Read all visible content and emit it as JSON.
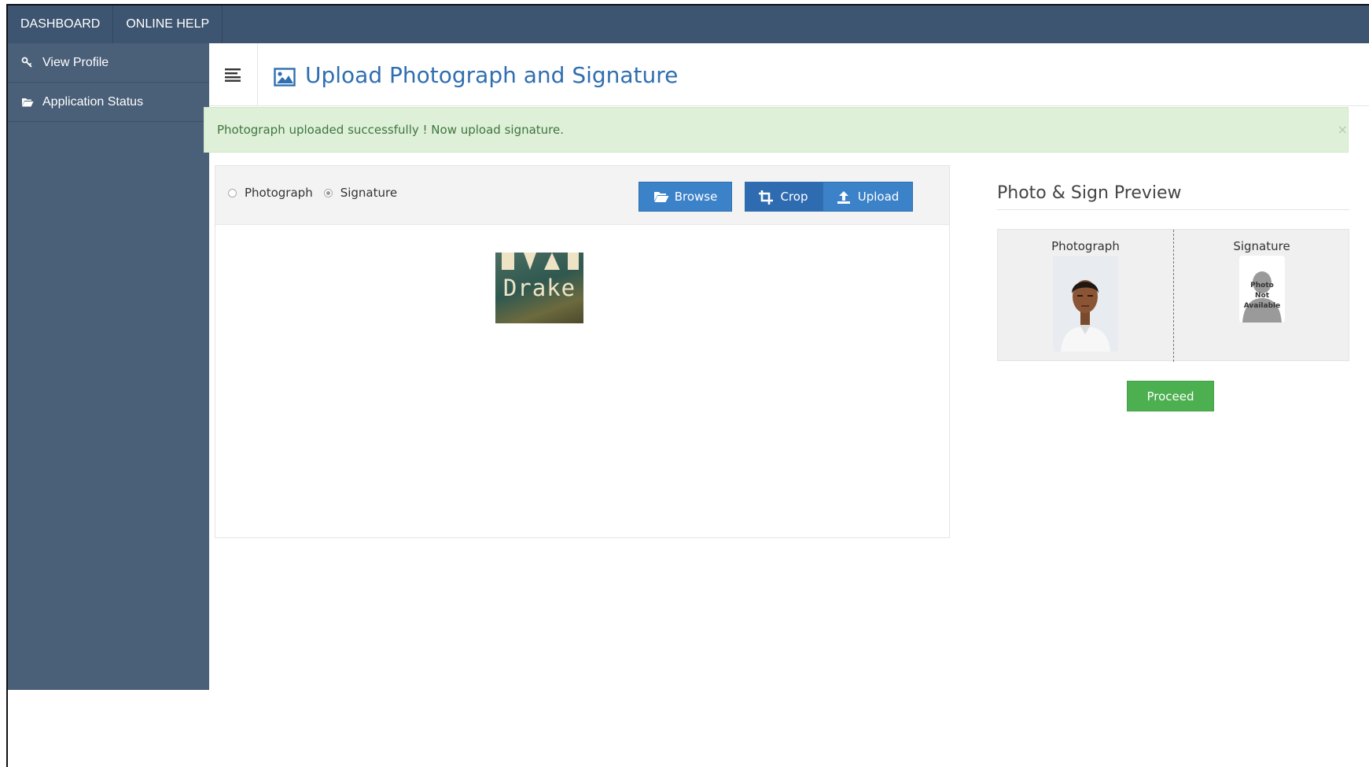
{
  "topnav": {
    "items": [
      {
        "label": "DASHBOARD"
      },
      {
        "label": "ONLINE HELP"
      }
    ]
  },
  "sidebar": {
    "items": [
      {
        "label": "View Profile",
        "icon": "key-icon"
      },
      {
        "label": "Application Status",
        "icon": "folder-open-icon"
      }
    ]
  },
  "header": {
    "title": "Upload Photograph and Signature",
    "title_icon": "image-icon",
    "menu_icon": "hamburger-icon"
  },
  "alert": {
    "message": "Photograph uploaded successfully ! Now upload signature.",
    "close": "×"
  },
  "uploader": {
    "options": [
      {
        "label": "Photograph",
        "selected": false
      },
      {
        "label": "Signature",
        "selected": true
      }
    ],
    "buttons": {
      "browse": "Browse",
      "crop": "Crop",
      "upload": "Upload"
    },
    "current_image_text": "Drake"
  },
  "preview": {
    "title": "Photo & Sign Preview",
    "photo_label": "Photograph",
    "signature_label": "Signature",
    "signature_placeholder": [
      "Photo",
      "Not",
      "Available"
    ]
  },
  "actions": {
    "proceed": "Proceed"
  },
  "colors": {
    "topbar": "#3d5570",
    "sidebar": "#4a5f78",
    "title": "#2f6eb0",
    "primary_button": "#3c82c8",
    "success_button": "#4caf50",
    "alert_bg": "#dff0d8",
    "alert_text": "#3c763d"
  }
}
